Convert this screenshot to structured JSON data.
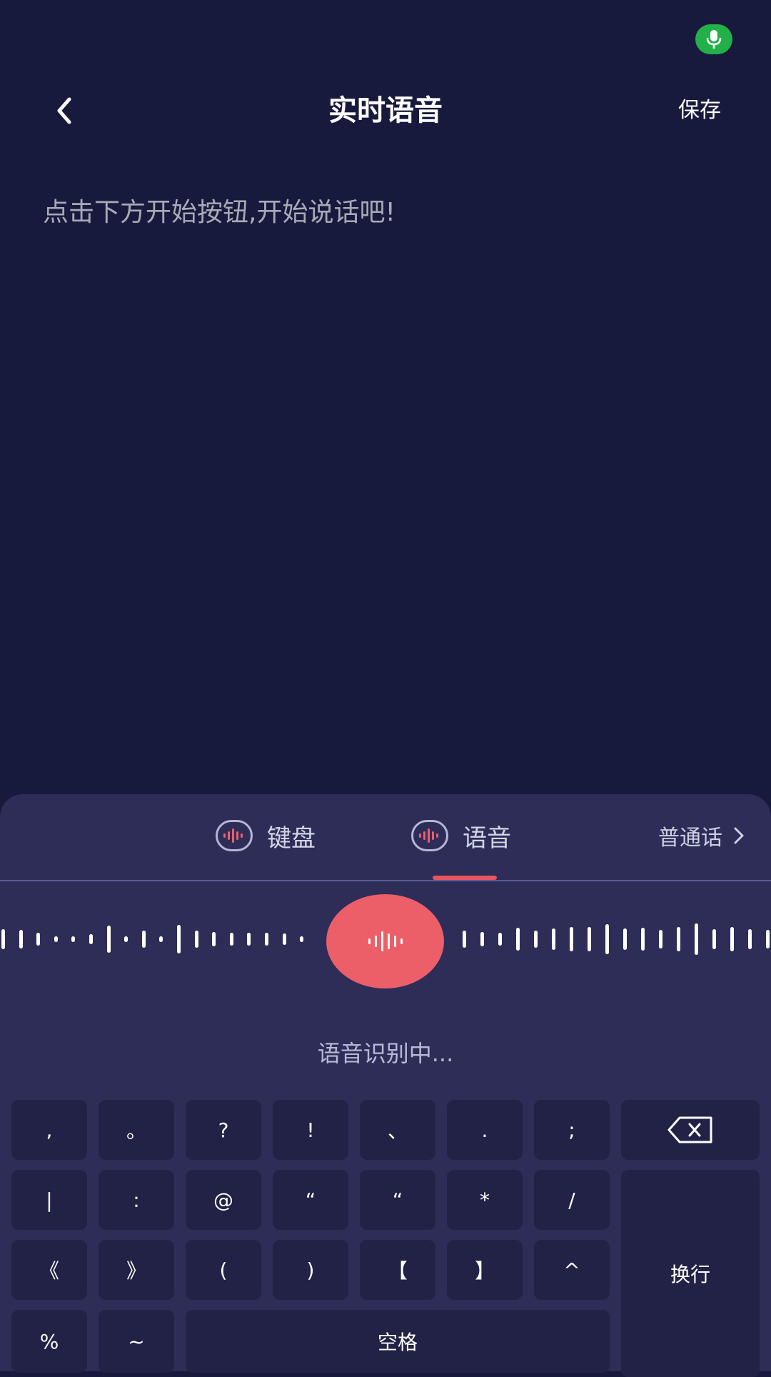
{
  "header": {
    "title": "实时语音",
    "save_label": "保存"
  },
  "content": {
    "hint": "点击下方开始按钮,开始说话吧!"
  },
  "mode_bar": {
    "keyboard_label": "键盘",
    "voice_label": "语音",
    "language": "普通话"
  },
  "recognition": {
    "status": "语音识别中..."
  },
  "keyboard": {
    "row1": [
      ",",
      "。",
      "?",
      "!",
      "、",
      ".",
      ";"
    ],
    "row2": [
      "|",
      ":",
      "@",
      "“",
      "“",
      "*",
      "/"
    ],
    "row3": [
      "《",
      "》",
      "(",
      ")",
      "【",
      "】",
      "^"
    ],
    "row4": [
      "%",
      "~"
    ],
    "space_label": "空格",
    "enter_label": "换行"
  },
  "colors": {
    "background": "#181a3d",
    "panel": "#2d2d58",
    "key": "#222247",
    "accent_red": "#ec5f69",
    "mic_green": "#23b049"
  }
}
